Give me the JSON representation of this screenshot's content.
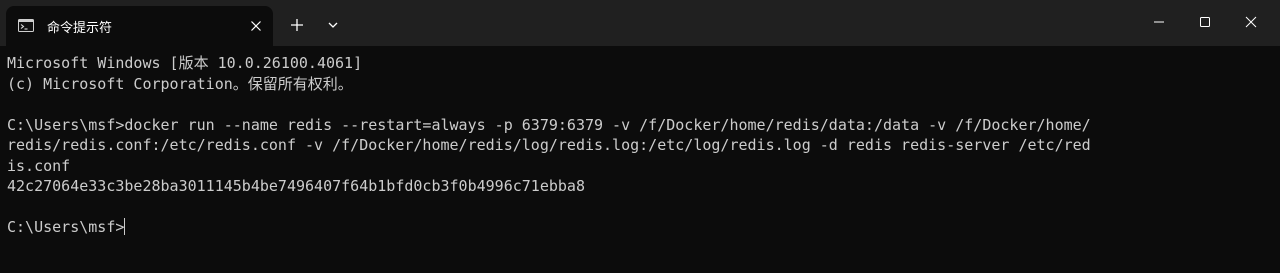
{
  "window": {
    "tab_title": "命令提示符"
  },
  "icons": {
    "tab": "cmd-icon",
    "close_tab": "close-icon",
    "new_tab": "plus-icon",
    "dropdown": "chevron-down-icon",
    "minimize": "minimize-icon",
    "maximize": "maximize-icon",
    "close_window": "close-icon"
  },
  "terminal": {
    "lines": [
      "Microsoft Windows [版本 10.0.26100.4061]",
      "(c) Microsoft Corporation。保留所有权利。",
      "",
      "C:\\Users\\msf>docker run --name redis --restart=always -p 6379:6379 -v /f/Docker/home/redis/data:/data -v /f/Docker/home/",
      "redis/redis.conf:/etc/redis.conf -v /f/Docker/home/redis/log/redis.log:/etc/log/redis.log -d redis redis-server /etc/red",
      "is.conf",
      "42c27064e33c3be28ba3011145b4be7496407f64b1bfd0cb3f0b4996c71ebba8",
      "",
      "C:\\Users\\msf>"
    ]
  },
  "colors": {
    "terminal_bg": "#0c0c0c",
    "titlebar_bg": "#202020",
    "text": "#cccccc"
  }
}
